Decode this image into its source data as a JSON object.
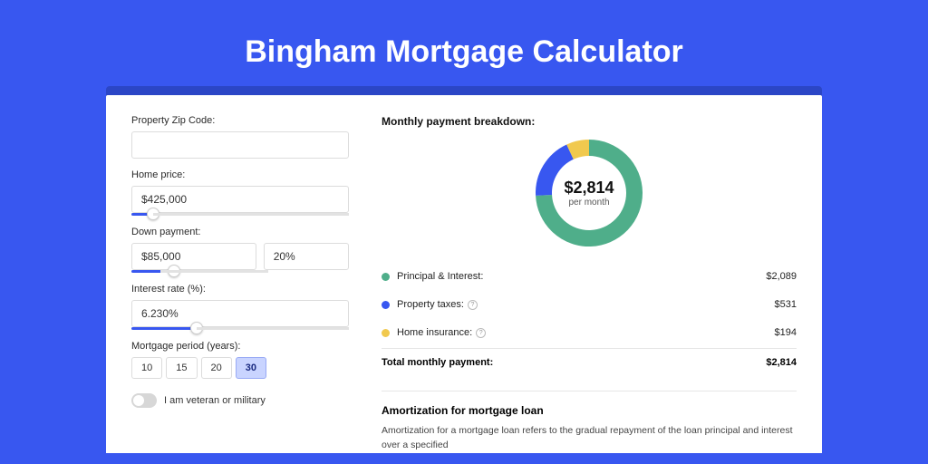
{
  "title": "Bingham Mortgage Calculator",
  "form": {
    "zip_label": "Property Zip Code:",
    "zip_value": "",
    "price_label": "Home price:",
    "price_value": "$425,000",
    "price_fill_pct": "10%",
    "dp_label": "Down payment:",
    "dp_amount": "$85,000",
    "dp_percent": "20%",
    "dp_fill_pct": "20%",
    "rate_label": "Interest rate (%):",
    "rate_value": "6.230%",
    "rate_fill_pct": "30%",
    "period_label": "Mortgage period (years):",
    "periods": [
      "10",
      "15",
      "20",
      "30"
    ],
    "period_active_index": 3,
    "veteran_label": "I am veteran or military"
  },
  "breakdown": {
    "title": "Monthly payment breakdown:",
    "center_value": "$2,814",
    "center_sub": "per month",
    "items": [
      {
        "label": "Principal & Interest:",
        "value": "$2,089",
        "color": "#4fae8a",
        "has_info": false
      },
      {
        "label": "Property taxes:",
        "value": "$531",
        "color": "#3857f0",
        "has_info": true
      },
      {
        "label": "Home insurance:",
        "value": "$194",
        "color": "#f1c94e",
        "has_info": true
      }
    ],
    "total_label": "Total monthly payment:",
    "total_value": "$2,814"
  },
  "amortization": {
    "title": "Amortization for mortgage loan",
    "text": "Amortization for a mortgage loan refers to the gradual repayment of the loan principal and interest over a specified"
  },
  "chart_data": {
    "type": "pie",
    "title": "Monthly payment breakdown",
    "series": [
      {
        "name": "Principal & Interest",
        "value": 2089,
        "color": "#4fae8a"
      },
      {
        "name": "Property taxes",
        "value": 531,
        "color": "#3857f0"
      },
      {
        "name": "Home insurance",
        "value": 194,
        "color": "#f1c94e"
      }
    ],
    "total": 2814,
    "center_label": "$2,814 per month"
  }
}
